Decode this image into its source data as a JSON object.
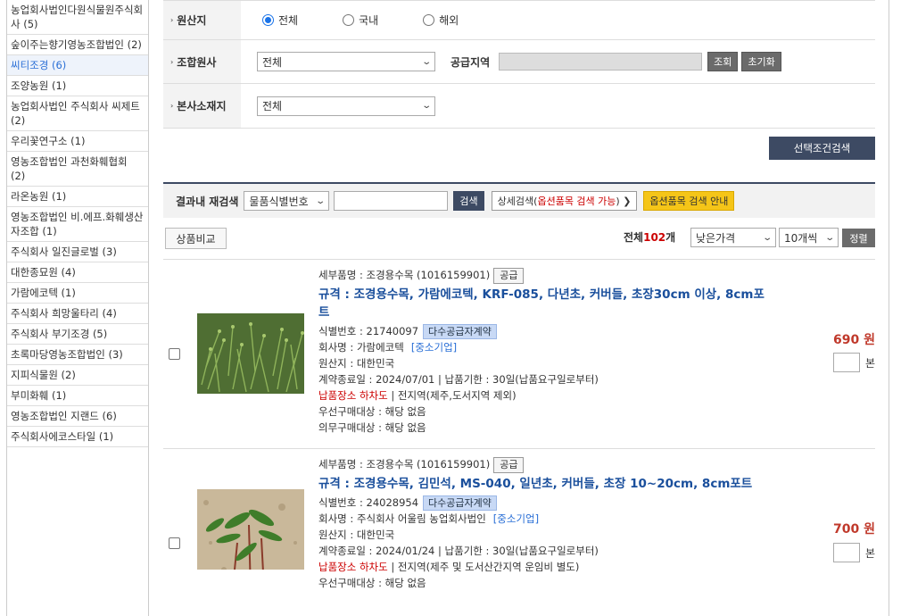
{
  "sidebar": {
    "items": [
      "농업회사법인다원식물원주식회사 (5)",
      "숲이주는향기영농조합법인 (2)",
      "씨티조경 (6)",
      "조양농원 (1)",
      "농업회사법인 주식회사 씨제트 (2)",
      "우리꽃연구소 (1)",
      "영농조합법인 과천화훼협회 (2)",
      "라온농원 (1)",
      "영농조합법인 비.에프.화훼생산자조합 (1)",
      "주식회사 일진글로벌 (3)",
      "대한종묘원 (4)",
      "가람에코텍 (1)",
      "주식회사 희망울타리 (4)",
      "주식회사 부기조경 (5)",
      "초록마당영농조합법인 (3)",
      "지피식물원 (2)",
      "부미화훼 (1)",
      "영농조합법인 지랜드 (6)",
      "주식회사에코스타일 (1)"
    ],
    "active_index": 2
  },
  "search": {
    "origin_label": "원산지",
    "origin_options": [
      "전체",
      "국내",
      "해외"
    ],
    "origin_selected": "전체",
    "union_label": "조합원사",
    "union_value": "전체",
    "supply_area_label": "공급지역",
    "inquiry_button": "조회",
    "reset_button": "초기화",
    "hq_label": "본사소재지",
    "hq_value": "전체",
    "submit_button": "선택조건검색"
  },
  "research": {
    "label": "결과내 재검색",
    "field_select": "물품식별번호",
    "search_button": "검색",
    "detail_button_prefix": "상세검색(",
    "detail_button_red": "옵션품목 검색 가능",
    "detail_button_suffix": ") ❯",
    "option_guide_button": "옵션품목 검색 안내"
  },
  "list_controls": {
    "compare_button": "상품비교",
    "total_label": "전체",
    "total_count": "102",
    "total_unit": "개",
    "sort_value": "낮은가격",
    "page_size": "10개씩",
    "sort_button": "정렬"
  },
  "products": [
    {
      "detail_name": "세부품명 : 조경용수목  (1016159901)",
      "supply_button": "공급",
      "title": "규격 : 조경용수목, 가람에코텍, KRF-085, 다년초, 커버들, 초장30cm 이상, 8cm포트",
      "id_label": "식별번호 : 21740097",
      "contract_tag": "다수공급자계약",
      "company_label": "회사명 : ",
      "company_name": "가람에코텍",
      "company_tag": "[중소기업]",
      "origin": "원산지 : 대한민국",
      "dates": "계약종료일 : 2024/07/01  |  납품기한 : 30일(납품요구일로부터)",
      "delivery_red": "납품장소 하차도",
      "delivery_rest": "  |  전지역(제주,도서지역 제외)",
      "priority": "우선구매대상 : 해당 없음",
      "mandatory": "의무구매대상 : 해당 없음",
      "price": "690 원",
      "qty_unit": "본"
    },
    {
      "detail_name": "세부품명 : 조경용수목  (1016159901)",
      "supply_button": "공급",
      "title": "규격 : 조경용수목, 김민석, MS-040, 일년초, 커버들, 초장 10~20cm, 8cm포트",
      "id_label": "식별번호 : 24028954",
      "contract_tag": "다수공급자계약",
      "company_label": "회사명 : ",
      "company_name": "주식회사 어울림 농업회사법인",
      "company_tag": "[중소기업]",
      "origin": "원산지 : 대한민국",
      "dates": "계약종료일 : 2024/01/24  |  납품기한 : 30일(납품요구일로부터)",
      "delivery_red": "납품장소 하차도",
      "delivery_rest": "  |  전지역(제주 및 도서산간지역 운임비 별도)",
      "priority": "우선구매대상 : 해당 없음",
      "price": "700 원",
      "qty_unit": "본"
    }
  ]
}
